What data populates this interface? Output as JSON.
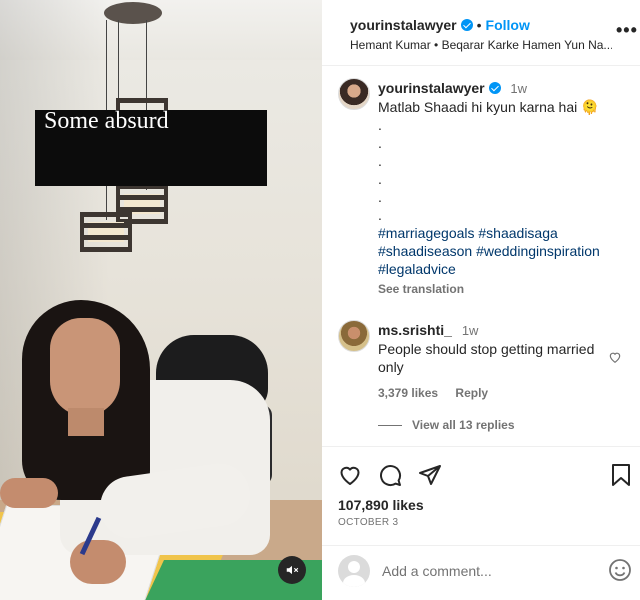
{
  "video": {
    "overlay_text": "Some absurd"
  },
  "header": {
    "username": "yourinstalawyer",
    "separator": "•",
    "follow_label": "Follow",
    "audio": "Hemant Kumar • Beqarar Karke Hamen Yun Na..."
  },
  "caption": {
    "username": "yourinstalawyer",
    "time": "1w",
    "text": "Matlab Shaadi hi kyun karna hai 🫠",
    "dots": [
      ".",
      ".",
      ".",
      ".",
      ".",
      "."
    ],
    "hashtags_line1": "#marriagegoals #shaadisaga",
    "hashtags_line2": "#shaadiseason #weddinginspiration",
    "hashtags_line3": "#legaladvice",
    "see_translation": "See translation"
  },
  "comment": {
    "username": "ms.srishti_",
    "time": "1w",
    "text": "People should stop getting married only",
    "likes": "3,379 likes",
    "reply": "Reply",
    "view_replies": "View all 13 replies"
  },
  "post": {
    "likes": "107,890 likes",
    "date": "OCTOBER 3"
  },
  "add_comment": {
    "placeholder": "Add a comment..."
  },
  "colors": {
    "accent": "#0095f6",
    "hashtag": "#00376b",
    "secondary_text": "#737373"
  },
  "icons": [
    "verified-badge-icon",
    "more-options-icon",
    "heart-icon",
    "comment-icon",
    "share-icon",
    "bookmark-icon",
    "emoji-icon",
    "mute-icon"
  ]
}
